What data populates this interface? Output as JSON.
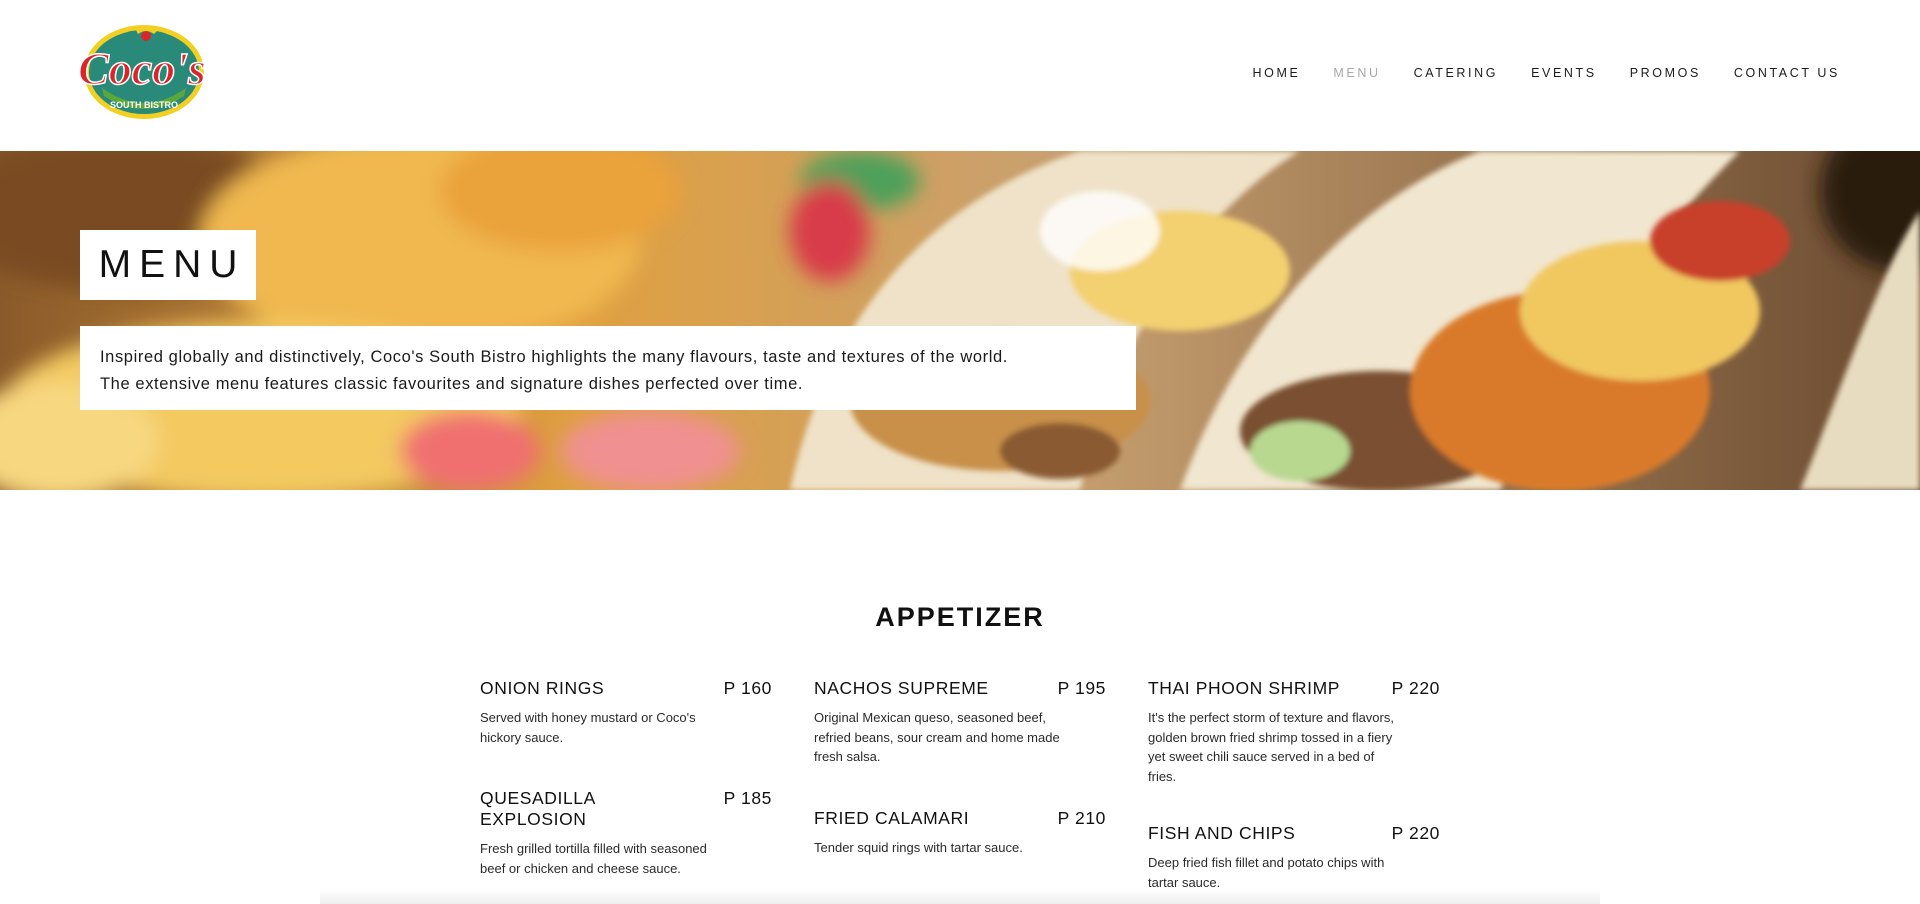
{
  "brand": {
    "logo_text": "Coco's",
    "logo_subtext": "SOUTH BISTRO",
    "colors": {
      "teal": "#2a8a7a",
      "red": "#d9262c",
      "yellow": "#f2d021",
      "green": "#5aa83a"
    }
  },
  "nav": {
    "items": [
      {
        "label": "HOME",
        "active": false
      },
      {
        "label": "MENU",
        "active": true
      },
      {
        "label": "CATERING",
        "active": false
      },
      {
        "label": "EVENTS",
        "active": false
      },
      {
        "label": "PROMOS",
        "active": false
      },
      {
        "label": "CONTACT US",
        "active": false
      }
    ]
  },
  "hero": {
    "title": "MENU",
    "description_lines": [
      "Inspired globally and distinctively, Coco's South Bistro highlights the many flavours, taste and textures of the world.",
      "The extensive menu features classic favourites and signature dishes perfected over time."
    ]
  },
  "menu": {
    "section_title": "APPETIZER",
    "columns": [
      [
        {
          "name": "ONION RINGS",
          "price": "P 160",
          "description": "Served with honey mustard or Coco's hickory sauce."
        },
        {
          "name": "QUESADILLA EXPLOSION",
          "price": "P 185",
          "description": "Fresh grilled tortilla filled with seasoned beef or chicken and cheese sauce."
        }
      ],
      [
        {
          "name": "NACHOS SUPREME",
          "price": "P 195",
          "description": "Original Mexican queso, seasoned beef, refried beans, sour cream and home made fresh salsa."
        },
        {
          "name": "FRIED CALAMARI",
          "price": "P 210",
          "description": "Tender squid rings with tartar sauce."
        }
      ],
      [
        {
          "name": "THAI PHOON SHRIMP",
          "price": "P 220",
          "description": "It's the perfect storm of texture and flavors, golden brown fried shrimp tossed in a fiery yet sweet chili sauce served in a bed of fries."
        },
        {
          "name": "FISH AND CHIPS",
          "price": "P 220",
          "description": "Deep fried fish fillet and potato chips with tartar sauce."
        }
      ]
    ]
  }
}
